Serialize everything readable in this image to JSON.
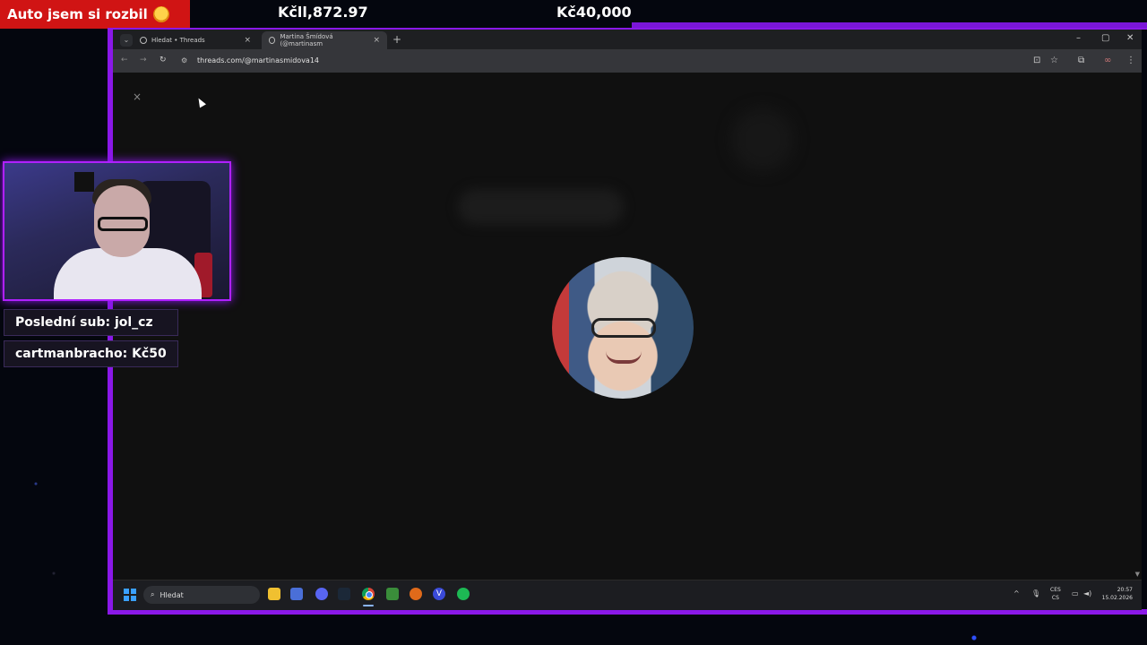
{
  "overlay": {
    "alert_text": "Auto jsem si rozbil",
    "goal1": "Kčll,872.97",
    "goal2": "Kč40,000",
    "last_sub": "Poslední sub: jol_cz",
    "last_donation": "cartmanbracho: Kč50"
  },
  "browser": {
    "tabs": [
      {
        "title": "Hledat • Threads",
        "close": "×"
      },
      {
        "title": "Martina Šmídová (@martinasm",
        "close": "×"
      }
    ],
    "new_tab": "+",
    "window_controls": {
      "minimize": "–",
      "maximize": "▢",
      "close": "✕"
    },
    "nav": {
      "back": "←",
      "forward": "→",
      "reload": "↻"
    },
    "url": "threads.com/@martinasmidova14",
    "toolbar_icons": {
      "install": "⊡",
      "star": "☆",
      "extensions": "⧉",
      "profile": "∞",
      "menu": "⋮"
    }
  },
  "page": {
    "close_icon": "×"
  },
  "taskbar": {
    "search_placeholder": "Hledat",
    "search_icon": "⌕",
    "apps": [
      "file-explorer",
      "notes",
      "discord",
      "steam",
      "chrome",
      "creator",
      "misc",
      "v-app",
      "spotify"
    ],
    "language_line1": "CES",
    "language_line2": "CS",
    "time": "20:57",
    "date": "15.02.2026",
    "tray_chevron": "^"
  },
  "colors": {
    "accent_purple": "#8a18e8",
    "alert_red": "#d01414",
    "page_bg": "#101010"
  }
}
